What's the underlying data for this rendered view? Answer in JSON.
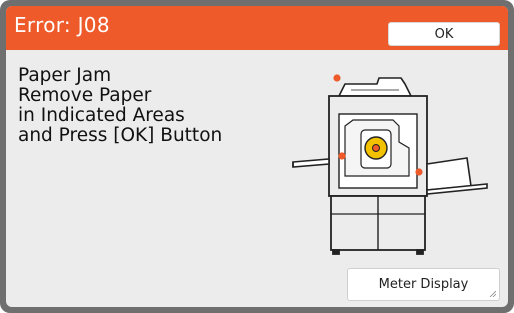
{
  "dialog": {
    "title": "Error: J08",
    "ok_label": "OK",
    "message_lines": [
      "Paper Jam",
      "Remove Paper",
      "in Indicated Areas",
      "and Press [OK] Button"
    ],
    "meter_display_label": "Meter Display"
  },
  "colors": {
    "title_bar": "#ee5a29",
    "panel_bg": "#ececec",
    "jam_marker": "#ee5a29",
    "drum_yellow": "#f2c200"
  },
  "illustration": {
    "name": "printer-paper-jam-diagram",
    "jam_markers": 3
  }
}
